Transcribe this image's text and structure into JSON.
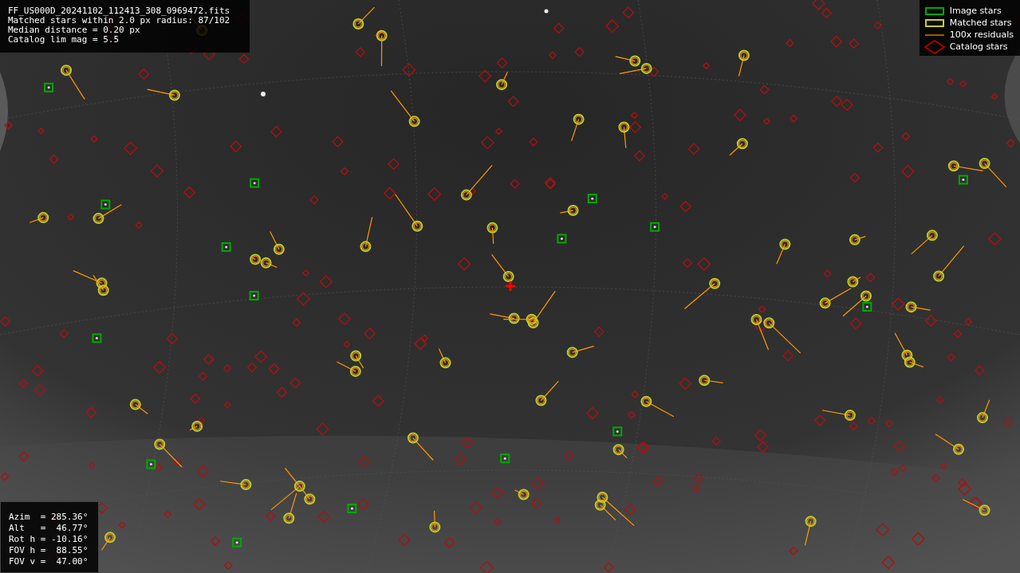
{
  "info": [
    "FF_US000D_20241102_112413_308_0969472.fits",
    "Matched stars within 2.0 px radius: 87/102",
    "Median distance = 0.20 px",
    "Catalog lim mag = 5.5"
  ],
  "legend": [
    {
      "kind": "image",
      "label": "Image stars"
    },
    {
      "kind": "matched",
      "label": "Matched stars"
    },
    {
      "kind": "residual",
      "label": "100x residuals"
    },
    {
      "kind": "catalog",
      "label": "Catalog stars"
    }
  ],
  "pointing": [
    "Azim  = 285.36°",
    "Alt   =  46.77°",
    "Rot h = -10.16°",
    "FOV h =  88.55°",
    "FOV v =  47.00°"
  ]
}
